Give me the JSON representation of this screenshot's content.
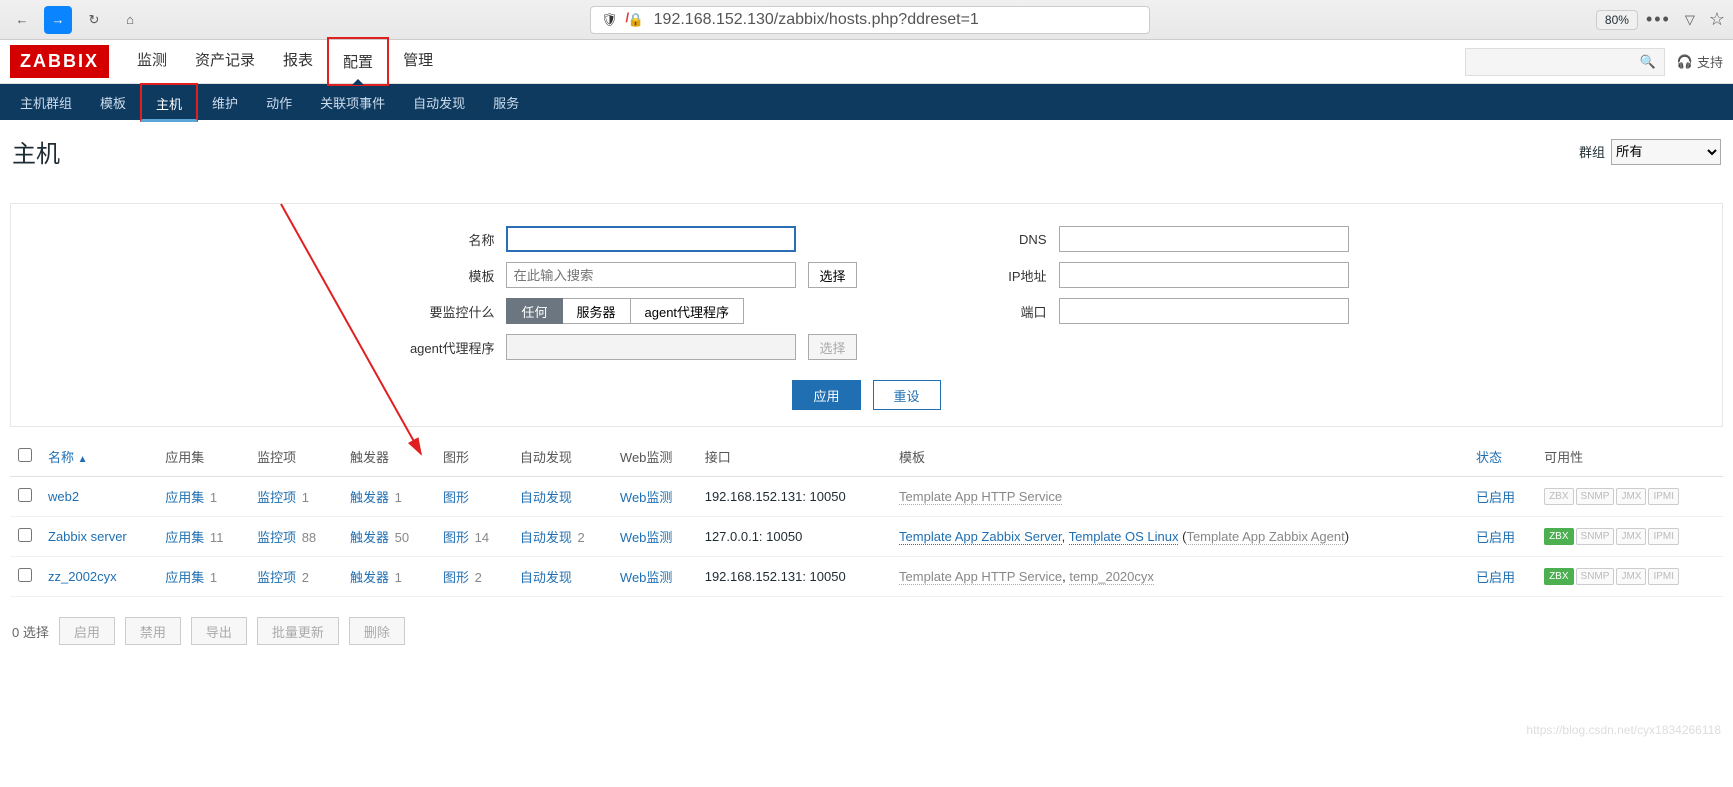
{
  "browser": {
    "url": "192.168.152.130/zabbix/hosts.php?ddreset=1",
    "zoom": "80%"
  },
  "logo": "ZABBIX",
  "top_nav": [
    "监测",
    "资产记录",
    "报表",
    "配置",
    "管理"
  ],
  "top_nav_active": 3,
  "support_label": "支持",
  "sub_nav": [
    "主机群组",
    "模板",
    "主机",
    "维护",
    "动作",
    "关联项事件",
    "自动发现",
    "服务"
  ],
  "sub_nav_active": 2,
  "page_title": "主机",
  "group_filter": {
    "label": "群组",
    "value": "所有"
  },
  "filter": {
    "name_label": "名称",
    "template_label": "模板",
    "template_placeholder": "在此输入搜索",
    "select_button": "选择",
    "monitor_label": "要监控什么",
    "monitor_options": [
      "任何",
      "服务器",
      "agent代理程序"
    ],
    "agent_proxy_label": "agent代理程序",
    "dns_label": "DNS",
    "ip_label": "IP地址",
    "port_label": "端口",
    "apply_button": "应用",
    "reset_button": "重设"
  },
  "table": {
    "headers": {
      "name": "名称",
      "apps": "应用集",
      "items": "监控项",
      "triggers": "触发器",
      "graphs": "图形",
      "discovery": "自动发现",
      "web": "Web监测",
      "interface": "接口",
      "templates": "模板",
      "status": "状态",
      "availability": "可用性"
    },
    "rows": [
      {
        "name": "web2",
        "apps": {
          "label": "应用集",
          "count": 1
        },
        "items": {
          "label": "监控项",
          "count": 1
        },
        "triggers": {
          "label": "触发器",
          "count": 1
        },
        "graphs": {
          "label": "图形",
          "count": ""
        },
        "discovery": {
          "label": "自动发现",
          "count": ""
        },
        "web": "Web监测",
        "interface": "192.168.152.131: 10050",
        "templates_html": "Template App HTTP Service",
        "status": "已启用",
        "zbx_ok": false
      },
      {
        "name": "Zabbix server",
        "apps": {
          "label": "应用集",
          "count": 11
        },
        "items": {
          "label": "监控项",
          "count": 88
        },
        "triggers": {
          "label": "触发器",
          "count": 50
        },
        "graphs": {
          "label": "图形",
          "count": 14
        },
        "discovery": {
          "label": "自动发现",
          "count": 2
        },
        "web": "Web监测",
        "interface": "127.0.0.1: 10050",
        "templates_html": "Template App Zabbix Server, Template OS Linux (Template App Zabbix Agent)",
        "status": "已启用",
        "zbx_ok": true
      },
      {
        "name": "zz_2002cyx",
        "apps": {
          "label": "应用集",
          "count": 1
        },
        "items": {
          "label": "监控项",
          "count": 2
        },
        "triggers": {
          "label": "触发器",
          "count": 1
        },
        "graphs": {
          "label": "图形",
          "count": 2
        },
        "discovery": {
          "label": "自动发现",
          "count": ""
        },
        "web": "Web监测",
        "interface": "192.168.152.131: 10050",
        "templates_html": "Template App HTTP Service, temp_2020cyx",
        "status": "已启用",
        "zbx_ok": true
      }
    ]
  },
  "footer": {
    "selected": "0 选择",
    "buttons": [
      "启用",
      "禁用",
      "导出",
      "批量更新",
      "删除"
    ]
  },
  "watermark": "https://blog.csdn.net/cyx1834266118",
  "avail_labels": [
    "ZBX",
    "SNMP",
    "JMX",
    "IPMI"
  ]
}
